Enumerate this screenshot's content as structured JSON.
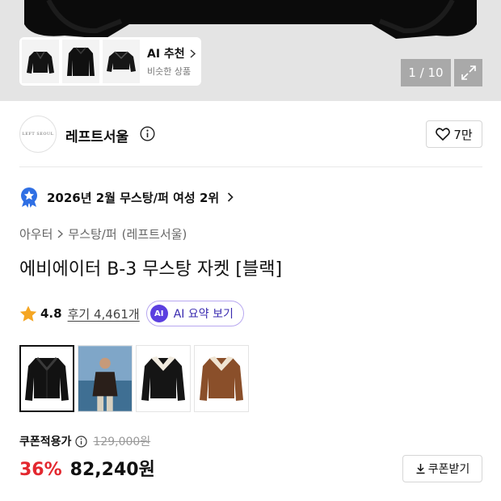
{
  "gallery": {
    "ai_rec_title": "AI 추천",
    "ai_rec_sub": "비슷한 상품",
    "counter": "1 / 10"
  },
  "store": {
    "logo_text": "LEFT SEOUL",
    "name": "레프트서울",
    "likes": "7만"
  },
  "ranking": {
    "text": "2026년 2월 무스탕/퍼 여성 2위"
  },
  "breadcrumb": {
    "category": "아우터",
    "subcategory": "무스탕/퍼",
    "brand": "(레프트서울)"
  },
  "product": {
    "title": "에비에이터 B-3 무스탕 자켓 [블랙]"
  },
  "rating": {
    "score": "4.8",
    "reviews": "후기 4,461개",
    "ai_badge": "AI",
    "ai_summary": "AI 요약 보기"
  },
  "price": {
    "coupon_label": "쿠폰적용가",
    "original": "129,000원",
    "discount": "36%",
    "sale": "82,240원",
    "coupon_button": "쿠폰받기"
  },
  "colors": {
    "accent_red": "#e3282f",
    "ai_purple": "#5b3fe0",
    "rank_badge_blue": "#2f6fe4"
  }
}
